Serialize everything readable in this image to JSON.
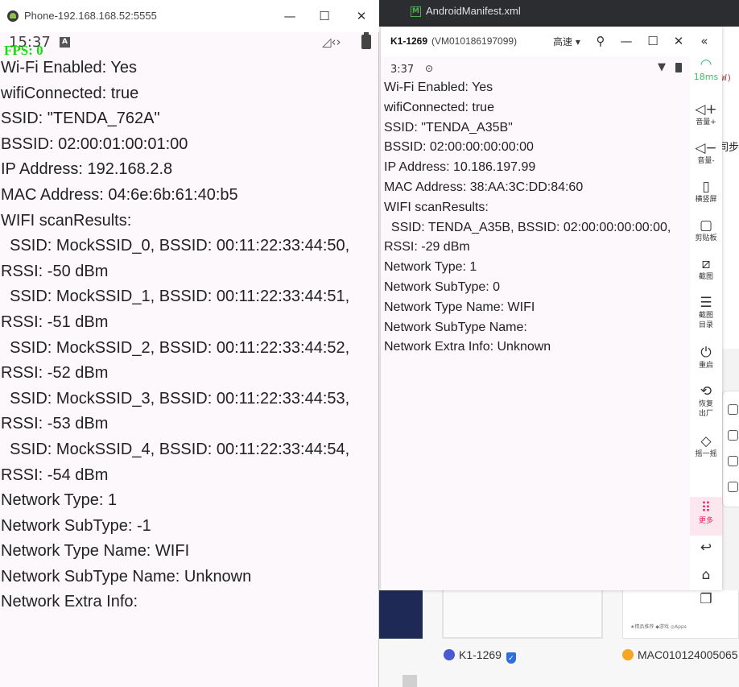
{
  "background": {
    "ide_tab_title": "AndroidManifest.xml",
    "right_hint_text": "W)",
    "right_text_tongbu": "同步",
    "devices": [
      {
        "name": "K1-1269",
        "dot_color": "#4a5bd1"
      },
      {
        "name": "MAC010124005065",
        "dot_color": "#f5a623"
      }
    ],
    "card_bar_text": "★精品推荐  ◆游戏  ◎Apps"
  },
  "phone1": {
    "window_title": "Phone-192.168.168.52:5555",
    "status_time": "15:37",
    "status_badge": "A",
    "fps": "FPS: 0",
    "lines": [
      "Wi-Fi Enabled: Yes",
      "wifiConnected: true",
      "SSID: \"TENDA_762A\"",
      "BSSID: 02:00:01:00:01:00",
      "IP Address: 192.168.2.8",
      "MAC Address: 04:6e:6b:61:40:b5",
      "WIFI scanResults:",
      "  SSID: MockSSID_0, BSSID: 00:11:22:33:44:50,",
      "RSSI: -50 dBm",
      "  SSID: MockSSID_1, BSSID: 00:11:22:33:44:51,",
      "RSSI: -51 dBm",
      "  SSID: MockSSID_2, BSSID: 00:11:22:33:44:52,",
      "RSSI: -52 dBm",
      "  SSID: MockSSID_3, BSSID: 00:11:22:33:44:53,",
      "RSSI: -53 dBm",
      "  SSID: MockSSID_4, BSSID: 00:11:22:33:44:54,",
      "RSSI: -54 dBm",
      "Network Type: 1",
      "Network SubType: -1",
      "Network Type Name: WIFI",
      "Network SubType Name: Unknown",
      "Network Extra Info:"
    ]
  },
  "phone2": {
    "device_name": "K1-1269",
    "device_id": "(VM010186197099)",
    "quality": "高速 ▾",
    "status_time": "3:37",
    "lines": [
      "Wi-Fi Enabled: Yes",
      "wifiConnected: true",
      "SSID: \"TENDA_A35B\"",
      "BSSID: 02:00:00:00:00:00",
      "IP Address: 10.186.197.99",
      "MAC Address: 38:AA:3C:DD:84:60",
      "WIFI scanResults:",
      "  SSID: TENDA_A35B, BSSID: 02:00:00:00:00:00,",
      "RSSI: -29 dBm",
      "Network Type: 1",
      "Network SubType: 0",
      "Network Type Name: WIFI",
      "Network SubType Name:",
      "Network Extra Info: Unknown"
    ],
    "sidebar": {
      "latency": "18ms",
      "items": [
        {
          "label": "音量+",
          "icon": "volume-up-icon"
        },
        {
          "label": "音量-",
          "icon": "volume-down-icon"
        },
        {
          "label": "横竖屏",
          "icon": "rotate-icon"
        },
        {
          "label": "剪贴板",
          "icon": "clipboard-icon"
        },
        {
          "label": "截图",
          "icon": "crop-icon"
        },
        {
          "label": "截图目录",
          "icon": "folder-icon"
        },
        {
          "label": "重启",
          "icon": "power-icon"
        },
        {
          "label": "恢复出厂",
          "icon": "reset-icon"
        },
        {
          "label": "摇一摇",
          "icon": "shake-icon"
        },
        {
          "label": "更多",
          "icon": "more-grid-icon"
        }
      ]
    }
  }
}
